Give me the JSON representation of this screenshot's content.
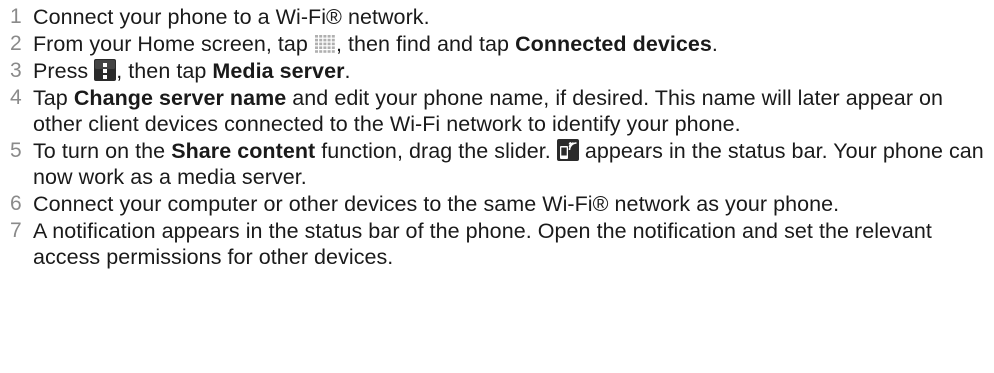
{
  "steps": [
    {
      "number": "1",
      "parts": [
        {
          "t": "Connect your phone to a Wi-Fi® network."
        }
      ]
    },
    {
      "number": "2",
      "parts": [
        {
          "t": "From your Home screen, tap "
        },
        {
          "icon": "app-grid-icon"
        },
        {
          "t": ", then find and tap "
        },
        {
          "b": "Connected devices"
        },
        {
          "t": "."
        }
      ]
    },
    {
      "number": "3",
      "parts": [
        {
          "t": "Press "
        },
        {
          "icon": "menu-key-icon"
        },
        {
          "t": ", then tap "
        },
        {
          "b": "Media server"
        },
        {
          "t": "."
        }
      ]
    },
    {
      "number": "4",
      "parts": [
        {
          "t": "Tap "
        },
        {
          "b": "Change server name"
        },
        {
          "t": " and edit your phone name, if desired. This name will later appear on other client devices connected to the Wi-Fi network to identify your phone."
        }
      ]
    },
    {
      "number": "5",
      "parts": [
        {
          "t": "To turn on the "
        },
        {
          "b": "Share content"
        },
        {
          "t": " function, drag the slider. "
        },
        {
          "icon": "media-server-status-icon"
        },
        {
          "t": " appears in the status bar. Your phone can now work as a media server."
        }
      ]
    },
    {
      "number": "6",
      "parts": [
        {
          "t": "Connect your computer or other devices to the same Wi-Fi® network as your phone."
        }
      ]
    },
    {
      "number": "7",
      "parts": [
        {
          "t": "A notification appears in the status bar of the phone. Open the notification and set the relevant access permissions for other devices."
        }
      ]
    }
  ]
}
